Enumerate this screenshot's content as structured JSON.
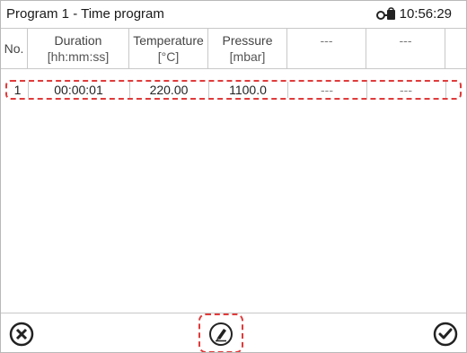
{
  "header": {
    "title": "Program 1 - Time program",
    "time": "10:56:29",
    "lock_icon": "lock-key-icon"
  },
  "table": {
    "columns": [
      {
        "line1": "No.",
        "line2": ""
      },
      {
        "line1": "Duration",
        "line2": "[hh:mm:ss]"
      },
      {
        "line1": "Temperature",
        "line2": "[°C]"
      },
      {
        "line1": "Pressure",
        "line2": "[mbar]"
      },
      {
        "line1": "---",
        "line2": ""
      },
      {
        "line1": "---",
        "line2": ""
      }
    ],
    "rows": [
      {
        "no": "1",
        "duration": "00:00:01",
        "temperature": "220.00",
        "pressure": "1100.0",
        "c5": "---",
        "c6": "---"
      }
    ]
  },
  "bottom": {
    "cancel_icon": "close-circle-icon",
    "edit_icon": "edit-pencil-icon",
    "confirm_icon": "check-circle-icon"
  },
  "colors": {
    "highlight": "#e03b3b",
    "border": "#c8c8c8"
  }
}
